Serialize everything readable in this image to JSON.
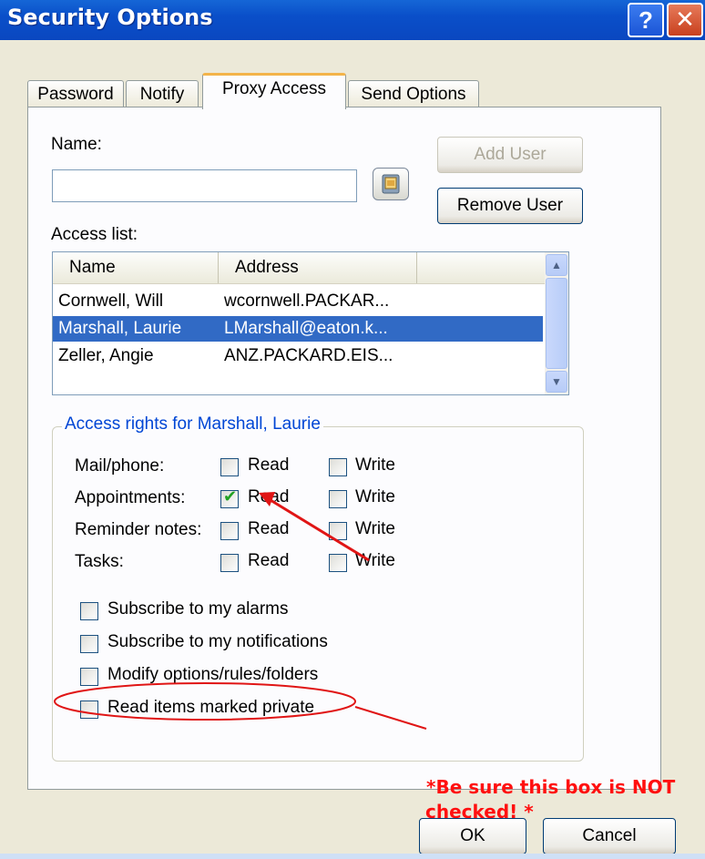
{
  "window": {
    "title": "Security Options"
  },
  "tabs": [
    {
      "label": "Password"
    },
    {
      "label": "Notify"
    },
    {
      "label": "Proxy Access"
    },
    {
      "label": "Send Options"
    }
  ],
  "name_label": "Name:",
  "name_input": {
    "value": ""
  },
  "add_user_label": "Add User",
  "remove_user_label": "Remove User",
  "access_list_label": "Access list:",
  "access_list": {
    "columns": [
      "Name",
      "Address"
    ],
    "rows": [
      {
        "name": "Cornwell, Will",
        "address": "wcornwell.PACKAR..."
      },
      {
        "name": "Marshall, Laurie",
        "address": "LMarshall@eaton.k..."
      },
      {
        "name": "Zeller, Angie",
        "address": "ANZ.PACKARD.EIS..."
      }
    ]
  },
  "rights": {
    "title": "Access rights for Marshall, Laurie",
    "read_label": "Read",
    "write_label": "Write",
    "items": [
      {
        "label": "Mail/phone:",
        "read": false,
        "write": false
      },
      {
        "label": "Appointments:",
        "read": true,
        "write": false
      },
      {
        "label": "Reminder notes:",
        "read": false,
        "write": false
      },
      {
        "label": "Tasks:",
        "read": false,
        "write": false
      }
    ]
  },
  "options": [
    {
      "label": "Subscribe to my alarms",
      "checked": false
    },
    {
      "label": "Subscribe to my notifications",
      "checked": false
    },
    {
      "label": "Modify options/rules/folders",
      "checked": false
    },
    {
      "label": "Read items marked private",
      "checked": false
    }
  ],
  "annotation": {
    "line1": "*Be sure this box is NOT",
    "line2": "checked! *",
    "color": "#ff1010"
  },
  "ok_label": "OK",
  "cancel_label": "Cancel",
  "colors": {
    "titlebar": "#0a47c0",
    "selection": "#316ac5",
    "group_title": "#0046d5",
    "tab_highlight": "#f3b44a"
  }
}
